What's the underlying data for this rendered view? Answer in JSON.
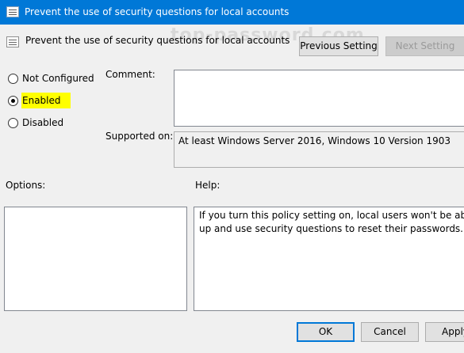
{
  "window": {
    "title": "Prevent the use of security questions for local accounts"
  },
  "header": {
    "policy_name": "Prevent the use of security questions for local accounts",
    "watermark": "top-password.com",
    "prev_button": "Previous Setting",
    "next_button": "Next Setting"
  },
  "state_options": {
    "items": [
      {
        "label": "Not Configured",
        "checked": false
      },
      {
        "label": "Enabled",
        "checked": true,
        "highlight": "#ffff00"
      },
      {
        "label": "Disabled",
        "checked": false
      }
    ]
  },
  "comment": {
    "label": "Comment:",
    "value": ""
  },
  "supported": {
    "label": "Supported on:",
    "value": "At least Windows Server 2016, Windows 10 Version 1903"
  },
  "options": {
    "label": "Options:"
  },
  "help": {
    "label": "Help:",
    "lines": [
      "If you turn this policy setting on, local users won't be able to set",
      "up and use security questions to reset their passwords."
    ]
  },
  "footer": {
    "ok": "OK",
    "cancel": "Cancel",
    "apply": "Apply"
  },
  "colors": {
    "titlebar": "#0078d7",
    "highlight": "#ffff00",
    "focus_border": "#0078d7"
  }
}
